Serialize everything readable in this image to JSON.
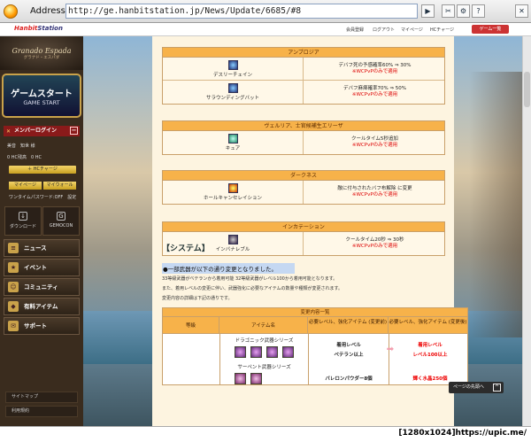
{
  "browser": {
    "address_label": "Address:",
    "url": "http://ge.hanbitstation.jp/News/Update/6685/#8"
  },
  "topnav": {
    "brand": "Hanbit",
    "brand2": "Station",
    "links": [
      "会員登録",
      "ログアウト",
      "マイページ",
      "HCチャージ"
    ],
    "game_button": "ゲーム一覧"
  },
  "sidebar": {
    "logo": "Granado Espada",
    "logo_sub": "グラナド・エスパダ",
    "start_jp": "ゲームスタート",
    "start_en": "GAME START",
    "login_label": "メンバーログイン",
    "user_name": "美音　知世 様",
    "hc_balance": "0 HC残高　0 HC",
    "hc_charge": "＋ HCチャージ",
    "mypage": "マイページ",
    "mywallet": "マイウォール",
    "onetime": "ワンタイムパスワード:OFF　設定",
    "download": "ダウンロード",
    "gemocon": "GEMOCON",
    "menu": [
      "ニュース",
      "イベント",
      "コミュニティ",
      "有料アイテム",
      "サポート"
    ],
    "footer_links": [
      "サイトマップ",
      "利用規約"
    ]
  },
  "skills": [
    {
      "category": "アンブロジア",
      "rows": [
        {
          "name": "デスリーチェイン",
          "desc": "デバフ死の予感確率60% ⇒ 30%",
          "note": "※WCPvPのみで適用"
        },
        {
          "name": "サラウンディングバット",
          "desc": "デバフ麻痺確率70% ⇒ 50%",
          "note": "※WCPvPのみで適用"
        }
      ]
    },
    {
      "category": "ヴェルリア、士官候補生エリーザ",
      "rows": [
        {
          "name": "キュア",
          "desc": "クールタイム5秒追加",
          "note": "※WCPvPのみで適用"
        }
      ]
    },
    {
      "category": "ダークネス",
      "rows": [
        {
          "name": "ホールキャンセレイション",
          "desc": "敵に付与されたバフ布解除 に変更",
          "note": "※WCPvPのみで適用"
        }
      ]
    },
    {
      "category": "インカテーション",
      "rows": [
        {
          "name": "インバナレブル",
          "desc": "クールタイム20秒 ⇒ 30秒",
          "note": "※WCPvPのみで適用"
        }
      ]
    }
  ],
  "system": {
    "heading": "【システム】",
    "bullet": "●一部武器が以下の通り変更となりました。",
    "lines": [
      "33等級武器がベテランから着用可能 32等級武器がレベル100から着用可能となります。",
      "また、着用レベルの変更に伴い、武器強化に必要なアイテムの数量や種類が変更されます。",
      "変更内容の詳細は下記の通りです。"
    ]
  },
  "table": {
    "title": "変更内容一覧",
    "headers": [
      "等級",
      "アイテム名",
      "必要レベル、強化アイテム (変更前)",
      "必要レベル、強化アイテム (変更後)"
    ],
    "row_series1": "ドラゴニック武器シリーズ",
    "row_series2": "サーペント武器シリーズ",
    "before1": "着用レベル",
    "before2": "ベテラン以上",
    "before3": "バレロンパウダー8個",
    "after1": "着用レベル",
    "after2": "レベル100以上",
    "after3": "輝く水晶250個"
  },
  "pagetop": "ページの先頭へ",
  "watermark": "[1280x1024]https://upic.me/"
}
